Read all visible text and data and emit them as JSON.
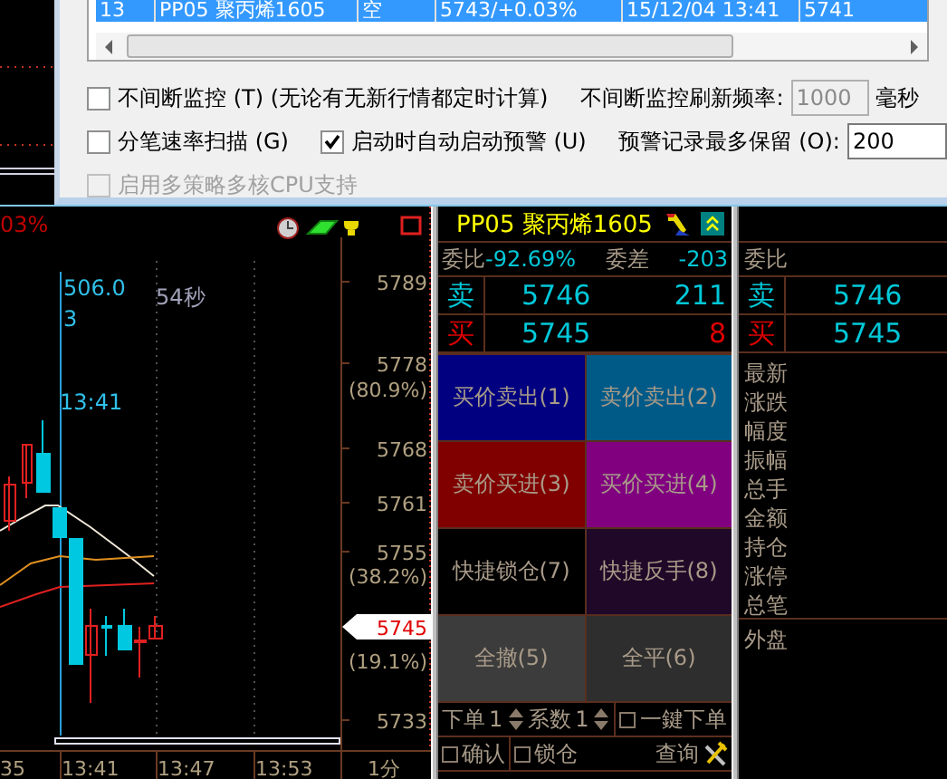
{
  "dialog": {
    "list_row": {
      "selected": true,
      "cells": [
        "13",
        "PP05 聚丙烯1605",
        "空",
        "5743/+0.03%",
        "15/12/04 13:41",
        "5741"
      ]
    },
    "rows": [
      {
        "items": [
          {
            "kind": "checkbox",
            "label": "不间断监控 (T) (无论有无新行情都定时计算)",
            "checked": false,
            "disabled": false
          },
          {
            "kind": "field",
            "label": "不间断监控刷新频率:",
            "value": "1000",
            "unit": "毫秒",
            "disabled": true
          }
        ]
      },
      {
        "items": [
          {
            "kind": "checkbox",
            "label": "分笔速率扫描 (G)",
            "checked": false,
            "disabled": false
          },
          {
            "kind": "checkbox",
            "label": "启动时自动启动预警 (U)",
            "checked": true,
            "disabled": false
          },
          {
            "kind": "field",
            "label": "预警记录最多保留 (O):",
            "value": "200",
            "disabled": false
          }
        ]
      },
      {
        "items": [
          {
            "kind": "checkbox",
            "label": "启用多策略多核CPU支持",
            "checked": false,
            "disabled": true
          }
        ]
      }
    ]
  },
  "chart": {
    "change": "03%",
    "cursor": {
      "value": "506.0",
      "volume": "3",
      "time": "13:41"
    },
    "countdown": "54秒",
    "price_labels": [
      "5789",
      "5778",
      "(80.9%)",
      "5768",
      "5761",
      "5755",
      "(38.2%)",
      "(19.1%)",
      "5733"
    ],
    "current_price": "5745",
    "time_labels": [
      "35",
      "13:41",
      "13:47",
      "13:53"
    ],
    "period": "1分"
  },
  "quote": {
    "symbol": "PP05 聚丙烯1605",
    "ratio_label": "委比",
    "ratio": "-92.69%",
    "diff_label": "委差",
    "diff": "-203",
    "levels": [
      {
        "kind": "sell",
        "label": "卖",
        "price": "5746",
        "volume": "211"
      },
      {
        "kind": "buy",
        "label": "买",
        "price": "5745",
        "volume": "8"
      }
    ],
    "actions": [
      {
        "label": "买价卖出(1)",
        "color": "#000080"
      },
      {
        "label": "卖价卖出(2)",
        "color": "#005a88"
      },
      {
        "label": "卖价买进(3)",
        "color": "#800000"
      },
      {
        "label": "买价买进(4)",
        "color": "#800080"
      },
      {
        "label": "快捷锁仓(7)",
        "color": "#000000"
      },
      {
        "label": "快捷反手(8)",
        "color": "#200828"
      },
      {
        "label": "全撤(5)",
        "color": "#3c3c3c"
      },
      {
        "label": "全平(6)",
        "color": "#2e2e2e"
      }
    ],
    "order_qty": {
      "label": "下单",
      "value": "1"
    },
    "multiplier": {
      "label": "系数",
      "value": "1"
    },
    "one_click": {
      "label": "一鍵下单",
      "checked": false
    },
    "confirm": {
      "label": "确认",
      "checked": false
    },
    "lock": {
      "label": "锁仓",
      "checked": false
    },
    "query": "查询"
  },
  "side_panel": {
    "ratio_label": "委比",
    "levels": [
      {
        "kind": "sell",
        "label": "卖",
        "price": "5746"
      },
      {
        "kind": "buy",
        "label": "买",
        "price": "5745"
      }
    ],
    "fields": [
      "最新",
      "涨跌",
      "幅度",
      "振幅",
      "总手",
      "金额",
      "持仓",
      "涨停",
      "总笔"
    ],
    "outer": "外盘"
  }
}
